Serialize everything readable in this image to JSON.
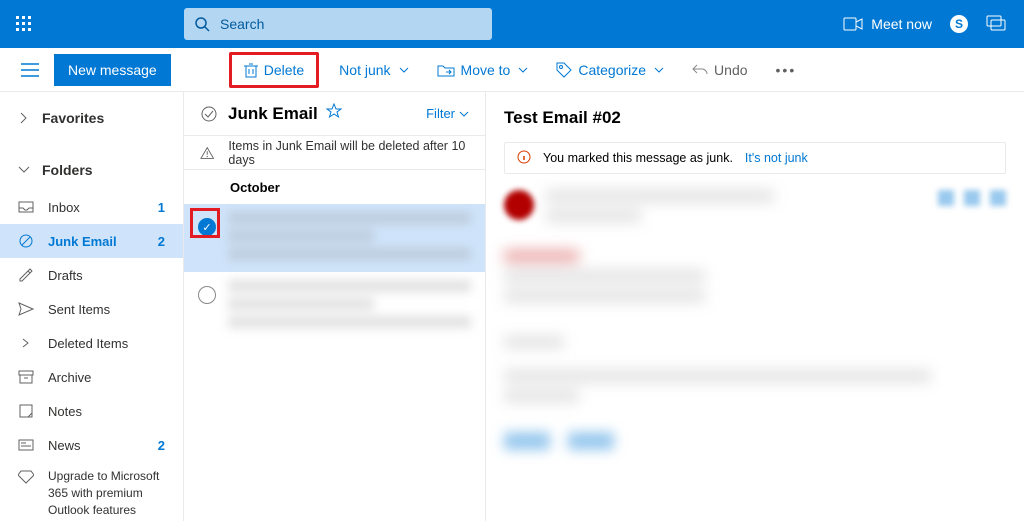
{
  "topbar": {
    "search_placeholder": "Search",
    "meet_now": "Meet now"
  },
  "cmdbar": {
    "new_message": "New message",
    "delete": "Delete",
    "not_junk": "Not junk",
    "move_to": "Move to",
    "categorize": "Categorize",
    "undo": "Undo"
  },
  "sidebar": {
    "favorites": "Favorites",
    "folders_label": "Folders",
    "folders": [
      {
        "name": "Inbox",
        "count": "1"
      },
      {
        "name": "Junk Email",
        "count": "2",
        "active": true
      },
      {
        "name": "Drafts",
        "count": ""
      },
      {
        "name": "Sent Items",
        "count": ""
      },
      {
        "name": "Deleted Items",
        "count": ""
      },
      {
        "name": "Archive",
        "count": ""
      },
      {
        "name": "Notes",
        "count": ""
      },
      {
        "name": "News",
        "count": "2"
      }
    ],
    "upgrade": "Upgrade to Microsoft 365 with premium Outlook features"
  },
  "msglist": {
    "title": "Junk Email",
    "filter": "Filter",
    "notice": "Items in Junk Email will be deleted after 10 days",
    "month": "October"
  },
  "reading": {
    "title": "Test Email #02",
    "junk_notice": "You marked this message as junk.",
    "not_junk_link": "It's not junk"
  }
}
